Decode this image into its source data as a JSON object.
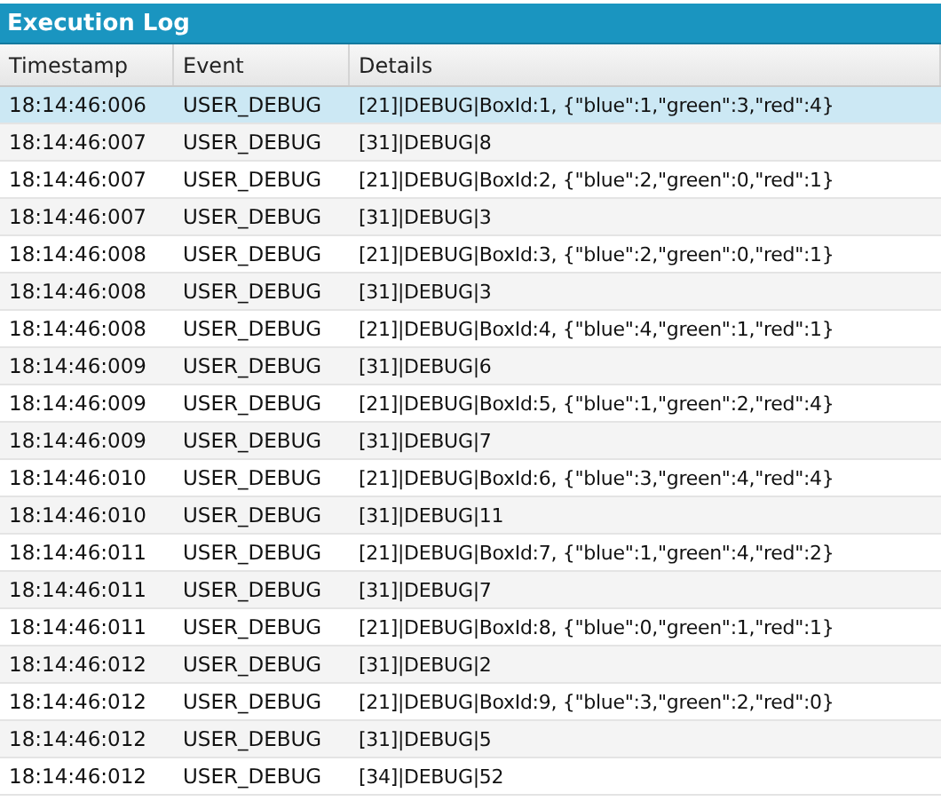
{
  "title": "Execution Log",
  "columns": [
    "Timestamp",
    "Event",
    "Details"
  ],
  "rows": [
    {
      "timestamp": "18:14:46:006",
      "event": "USER_DEBUG",
      "details": "[21]|DEBUG|BoxId:1, {\"blue\":1,\"green\":3,\"red\":4}",
      "selected": true
    },
    {
      "timestamp": "18:14:46:007",
      "event": "USER_DEBUG",
      "details": "[31]|DEBUG|8",
      "selected": false
    },
    {
      "timestamp": "18:14:46:007",
      "event": "USER_DEBUG",
      "details": "[21]|DEBUG|BoxId:2, {\"blue\":2,\"green\":0,\"red\":1}",
      "selected": false
    },
    {
      "timestamp": "18:14:46:007",
      "event": "USER_DEBUG",
      "details": "[31]|DEBUG|3",
      "selected": false
    },
    {
      "timestamp": "18:14:46:008",
      "event": "USER_DEBUG",
      "details": "[21]|DEBUG|BoxId:3, {\"blue\":2,\"green\":0,\"red\":1}",
      "selected": false
    },
    {
      "timestamp": "18:14:46:008",
      "event": "USER_DEBUG",
      "details": "[31]|DEBUG|3",
      "selected": false
    },
    {
      "timestamp": "18:14:46:008",
      "event": "USER_DEBUG",
      "details": "[21]|DEBUG|BoxId:4, {\"blue\":4,\"green\":1,\"red\":1}",
      "selected": false
    },
    {
      "timestamp": "18:14:46:009",
      "event": "USER_DEBUG",
      "details": "[31]|DEBUG|6",
      "selected": false
    },
    {
      "timestamp": "18:14:46:009",
      "event": "USER_DEBUG",
      "details": "[21]|DEBUG|BoxId:5, {\"blue\":1,\"green\":2,\"red\":4}",
      "selected": false
    },
    {
      "timestamp": "18:14:46:009",
      "event": "USER_DEBUG",
      "details": "[31]|DEBUG|7",
      "selected": false
    },
    {
      "timestamp": "18:14:46:010",
      "event": "USER_DEBUG",
      "details": "[21]|DEBUG|BoxId:6, {\"blue\":3,\"green\":4,\"red\":4}",
      "selected": false
    },
    {
      "timestamp": "18:14:46:010",
      "event": "USER_DEBUG",
      "details": "[31]|DEBUG|11",
      "selected": false
    },
    {
      "timestamp": "18:14:46:011",
      "event": "USER_DEBUG",
      "details": "[21]|DEBUG|BoxId:7, {\"blue\":1,\"green\":4,\"red\":2}",
      "selected": false
    },
    {
      "timestamp": "18:14:46:011",
      "event": "USER_DEBUG",
      "details": "[31]|DEBUG|7",
      "selected": false
    },
    {
      "timestamp": "18:14:46:011",
      "event": "USER_DEBUG",
      "details": "[21]|DEBUG|BoxId:8, {\"blue\":0,\"green\":1,\"red\":1}",
      "selected": false
    },
    {
      "timestamp": "18:14:46:012",
      "event": "USER_DEBUG",
      "details": "[31]|DEBUG|2",
      "selected": false
    },
    {
      "timestamp": "18:14:46:012",
      "event": "USER_DEBUG",
      "details": "[21]|DEBUG|BoxId:9, {\"blue\":3,\"green\":2,\"red\":0}",
      "selected": false
    },
    {
      "timestamp": "18:14:46:012",
      "event": "USER_DEBUG",
      "details": "[31]|DEBUG|5",
      "selected": false
    },
    {
      "timestamp": "18:14:46:012",
      "event": "USER_DEBUG",
      "details": "[34]|DEBUG|52",
      "selected": false
    }
  ]
}
